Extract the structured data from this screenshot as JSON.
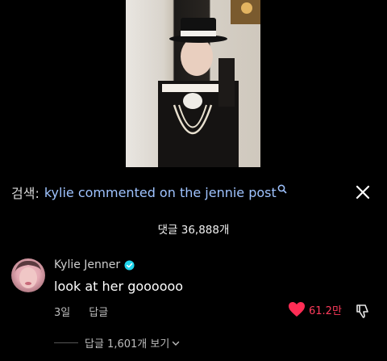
{
  "search": {
    "prefix": "검색:",
    "query": "kylie commented on the jennie post"
  },
  "comments": {
    "count_label": "댓글 36,888개"
  },
  "comment": {
    "username": "Kylie Jenner",
    "text": "look at her goooooo",
    "time": "3일",
    "reply_label": "답글",
    "likes": "61.2만",
    "view_replies_label": "답글 1,601개 보기"
  },
  "colors": {
    "background": "#000000",
    "search_query": "#9fc3ff",
    "like_red": "#ff3b5c",
    "verified_blue": "#20d5ec"
  },
  "icons": {
    "search": "search-icon",
    "close": "close-icon",
    "verified": "verified-badge-icon",
    "heart": "heart-icon",
    "dislike": "thumbs-down-icon",
    "chevron": "chevron-down-icon"
  }
}
